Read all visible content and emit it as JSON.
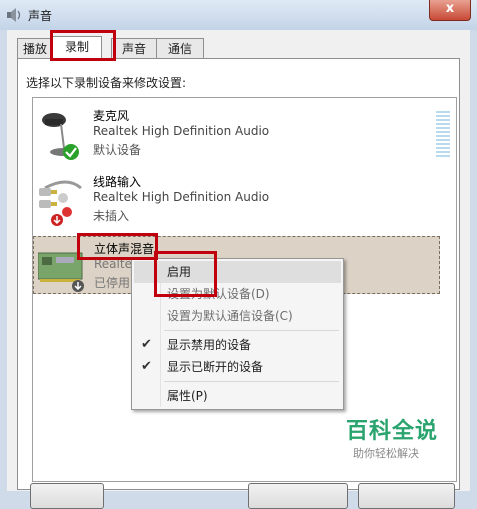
{
  "window": {
    "title": "声音",
    "close_symbol": "x"
  },
  "tabs": [
    {
      "label": "播放",
      "active": false
    },
    {
      "label": "录制",
      "active": true
    },
    {
      "label": "声音",
      "active": false
    },
    {
      "label": "通信",
      "active": false
    }
  ],
  "panel": {
    "instruction": "选择以下录制设备来修改设置:"
  },
  "devices": [
    {
      "name": "麦克风",
      "driver": "Realtek High Definition Audio",
      "status": "默认设备",
      "icon": "microphone-icon",
      "badge": "green-check-badge"
    },
    {
      "name": "线路输入",
      "driver": "Realtek High Definition Audio",
      "status": "未插入",
      "icon": "line-in-cable-icon",
      "badge": "red-arrow-badge"
    },
    {
      "name": "立体声混音",
      "driver": "Realte",
      "status": "已停用",
      "icon": "sound-card-icon",
      "badge": "down-arrow-badge"
    }
  ],
  "context_menu": {
    "items": [
      {
        "label": "启用",
        "state": "hover"
      },
      {
        "label": "设置为默认设备(D)",
        "state": "disabled"
      },
      {
        "label": "设置为默认通信设备(C)",
        "state": "disabled"
      },
      {
        "label": "显示禁用的设备",
        "checked": true
      },
      {
        "label": "显示已断开的设备",
        "checked": true
      },
      {
        "label": "属性(P)"
      }
    ],
    "check_glyph": "✔"
  },
  "watermark": {
    "title": "百科全说",
    "subtitle": "助你轻松解决"
  },
  "colors": {
    "highlight": "#c0000c",
    "watermark": "#2aa46e",
    "selection": "#dcd2c5"
  }
}
